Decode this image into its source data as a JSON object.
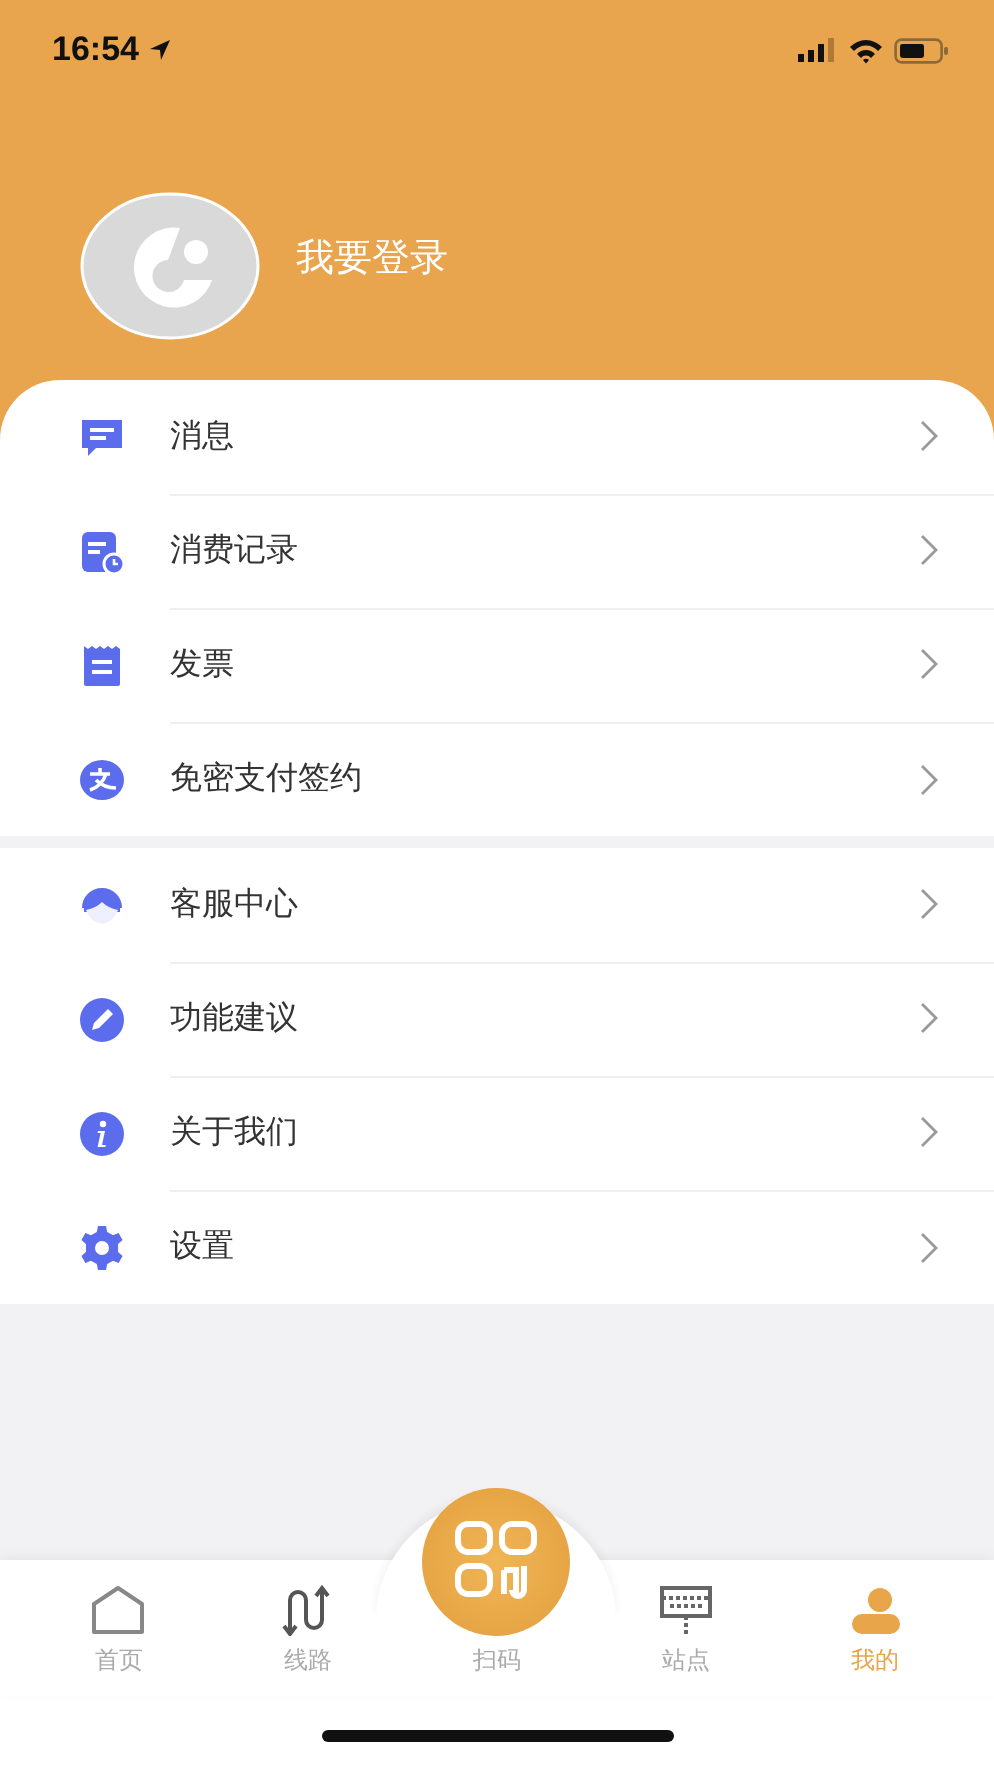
{
  "status_bar": {
    "time": "16:54"
  },
  "profile": {
    "login_label": "我要登录"
  },
  "menu_groups": [
    [
      {
        "label": "消息"
      },
      {
        "label": "消费记录"
      },
      {
        "label": "发票"
      },
      {
        "label": "免密支付签约"
      }
    ],
    [
      {
        "label": "客服中心"
      },
      {
        "label": "功能建议"
      },
      {
        "label": "关于我们"
      },
      {
        "label": "设置"
      }
    ]
  ],
  "tab_bar": [
    {
      "label": "首页",
      "kind": "plain",
      "selected": false
    },
    {
      "label": "线路",
      "kind": "plain",
      "selected": false
    },
    {
      "label": "扫码",
      "kind": "raised",
      "selected": false
    },
    {
      "label": "站点",
      "kind": "plain",
      "selected": false
    },
    {
      "label": "我的",
      "kind": "plain",
      "selected": true
    }
  ]
}
